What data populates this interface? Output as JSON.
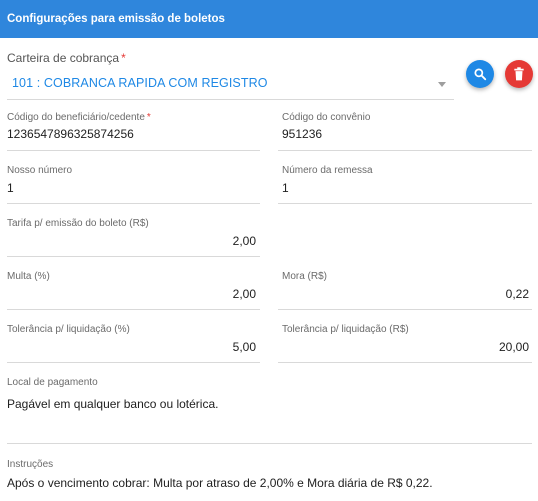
{
  "header": {
    "title": "Configurações para emissão de boletos"
  },
  "carteira": {
    "label": "Carteira de cobrança",
    "required_mark": "*",
    "selected": "101 : COBRANCA RAPIDA COM REGISTRO"
  },
  "icons": {
    "search": "search-icon",
    "delete": "trash-icon"
  },
  "colors": {
    "header": "#2f86dc",
    "accent": "#1e88e5",
    "danger": "#e53935"
  },
  "fields": {
    "codigo_beneficiario": {
      "label": "Código do beneficiário/cedente",
      "required_mark": "*",
      "value": "1236547896325874256"
    },
    "codigo_convenio": {
      "label": "Código do convênio",
      "value": "951236"
    },
    "nosso_numero": {
      "label": "Nosso número",
      "value": "1"
    },
    "numero_remessa": {
      "label": "Número da remessa",
      "value": "1"
    },
    "tarifa": {
      "label": "Tarifa p/ emissão do boleto (R$)",
      "value": "2,00"
    },
    "multa": {
      "label": "Multa (%)",
      "value": "2,00"
    },
    "mora": {
      "label": "Mora (R$)",
      "value": "0,22"
    },
    "tolerancia_pct": {
      "label": "Tolerância p/ liquidação (%)",
      "value": "5,00"
    },
    "tolerancia_rs": {
      "label": "Tolerância p/ liquidação (R$)",
      "value": "20,00"
    },
    "local_pagamento": {
      "label": "Local de pagamento",
      "value": "Pagável em qualquer banco ou lotérica."
    },
    "instrucoes": {
      "label": "Instruções",
      "value": "Após o vencimento cobrar: Multa por atraso de 2,00% e Mora diária de R$ 0,22."
    }
  }
}
